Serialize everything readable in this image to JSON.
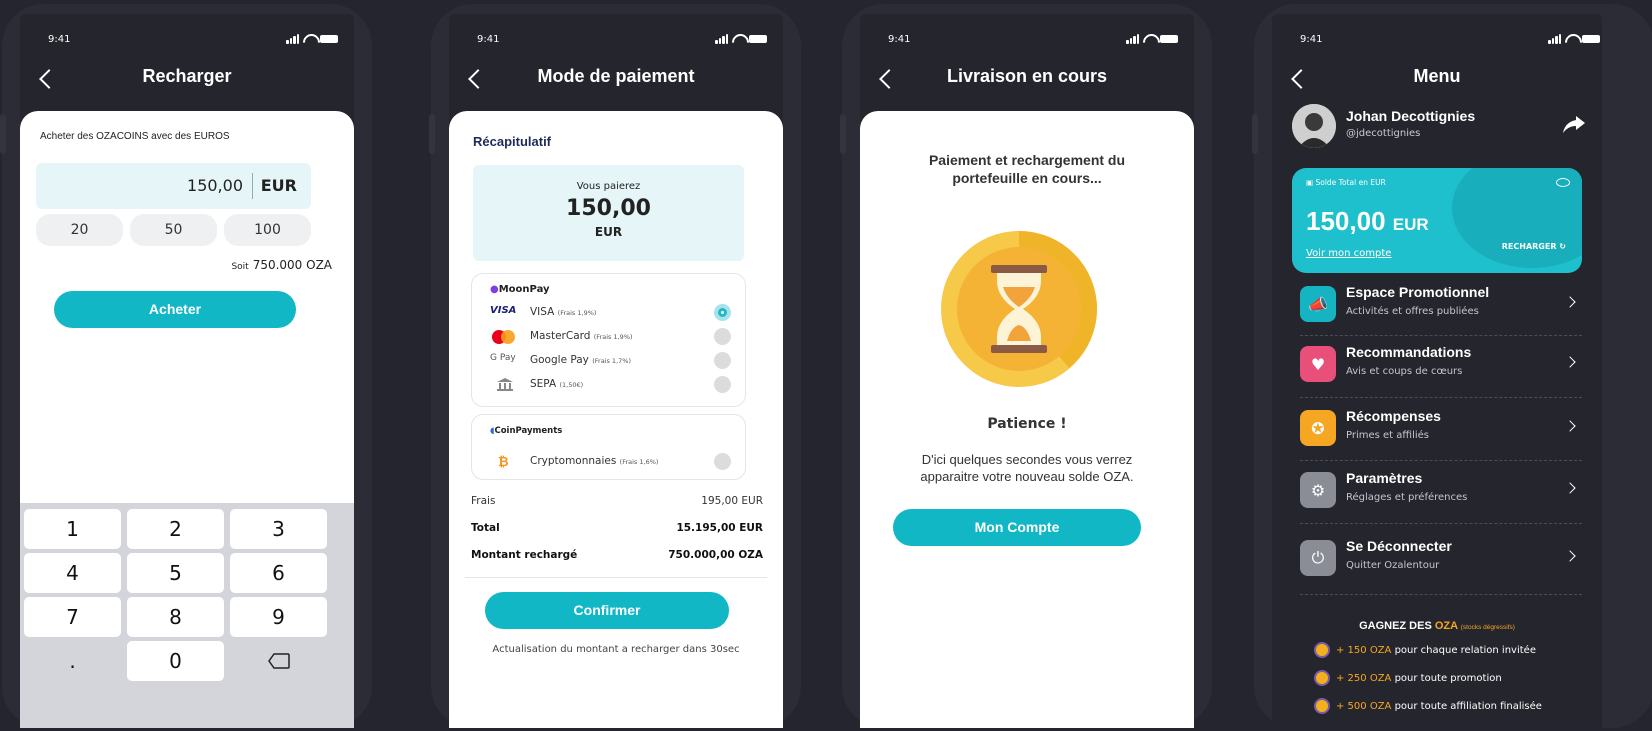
{
  "status": {
    "time": "9:41"
  },
  "screen1": {
    "title": "Recharger",
    "label": "Acheter des OZACOINS avec des EUROS",
    "amount": "150,00",
    "currency": "EUR",
    "quick": [
      "20",
      "50",
      "100"
    ],
    "soit_label": "Soit",
    "soit_value": "750.000 OZA",
    "buy": "Acheter",
    "keys": [
      "1",
      "2",
      "3",
      "4",
      "5",
      "6",
      "7",
      "8",
      "9",
      ".",
      "0"
    ]
  },
  "screen2": {
    "title": "Mode de paiement",
    "recap": "Récapitulatif",
    "pay_label": "Vous paierez",
    "pay_amount": "150,00",
    "pay_currency": "EUR",
    "moonpay": "MoonPay",
    "methods": [
      {
        "icon": "VISA",
        "name": "VISA",
        "fee": "(Frais 1,9%)"
      },
      {
        "icon": "",
        "name": "MasterCard",
        "fee": "(Frais 1,9%)"
      },
      {
        "icon": "G Pay",
        "name": "Google Pay",
        "fee": "(Frais 1,7%)"
      },
      {
        "icon": "",
        "name": "SEPA",
        "fee": "(1,50€)"
      }
    ],
    "coinpayments": "CoinPayments",
    "crypto": {
      "name": "Cryptomonnaies",
      "fee": "(Frais 1,6%)"
    },
    "frais_label": "Frais",
    "frais_value": "195,00 EUR",
    "total_label": "Total",
    "total_value": "15.195,00 EUR",
    "montant_label": "Montant rechargé",
    "montant_value": "750.000,00 OZA",
    "confirm": "Confirmer",
    "note": "Actualisation du montant a recharger dans 30sec"
  },
  "screen3": {
    "title": "Livraison en cours",
    "msg1": "Paiement et rechargement du",
    "msg2": "portefeuille en cours...",
    "patience": "Patience !",
    "sub1": "D'ici quelques secondes vous verrez",
    "sub2": "apparaitre votre nouveau solde OZA.",
    "button": "Mon Compte"
  },
  "screen4": {
    "title": "Menu",
    "name": "Johan Decottignies",
    "handle": "@jdecottignies",
    "balance_label": "Solde Total en EUR",
    "balance_amount": "150,00",
    "balance_currency": "EUR",
    "voir": "Voir mon compte",
    "recharger": "RECHARGER ↻",
    "items": [
      {
        "title": "Espace Promotionnel",
        "sub": "Activités et offres publiées",
        "color": "#16b3c2"
      },
      {
        "title": "Recommandations",
        "sub": "Avis et coups de cœurs",
        "color": "#e8507a"
      },
      {
        "title": "Récompenses",
        "sub": "Primes et affiliés",
        "color": "#f5a623"
      },
      {
        "title": "Paramètres",
        "sub": "Réglages et préférences",
        "color": "#8a8c96"
      },
      {
        "title": "Se Déconnecter",
        "sub": "Quitter Ozalentour",
        "color": "#8a8c96"
      }
    ],
    "gagnez_a": "GAGNEZ DES",
    "gagnez_b": "OZA",
    "gagnez_c": "(stocks dégressifs)",
    "earn": [
      {
        "amt": "+ 150 OZA",
        "txt": "pour chaque relation invitée"
      },
      {
        "amt": "+ 250 OZA",
        "txt": "pour toute promotion"
      },
      {
        "amt": "+ 500 OZA",
        "txt": "pour toute affiliation finalisée"
      }
    ]
  },
  "colors": {
    "accent": "#12b7c6",
    "background": "#25252f",
    "oza_orange": "#f5a623"
  }
}
